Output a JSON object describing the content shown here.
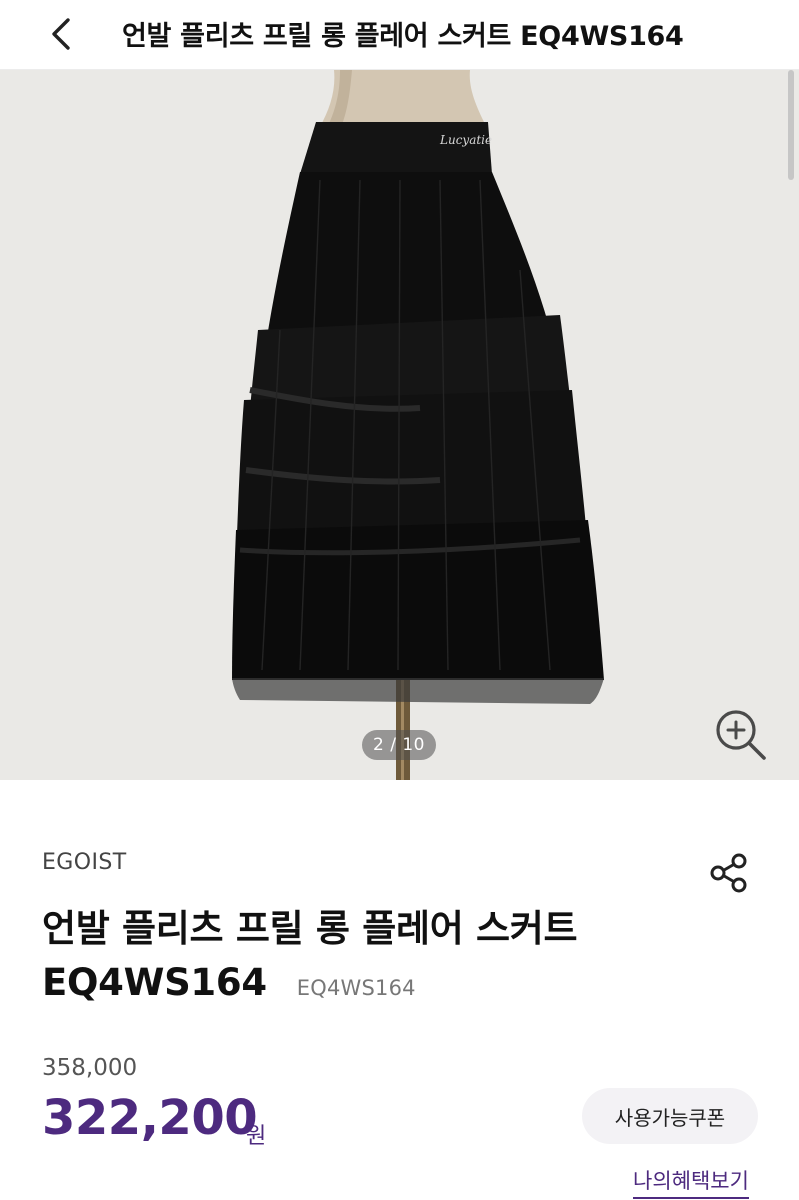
{
  "header": {
    "title": "언발 플리츠 프릴 롱 플레어 스커트 EQ4WS164"
  },
  "gallery": {
    "page_indicator": "2 / 10",
    "current": 2,
    "total": 10,
    "waistband_logo": "Lucyatie"
  },
  "product": {
    "brand": "EGOIST",
    "name": "언발 플리츠 프릴 롱 플레어 스커트 EQ4WS164",
    "code": "EQ4WS164",
    "original_price": "358,000",
    "sale_price": "322,200",
    "currency": "원",
    "coupon_button": "사용가능쿠폰",
    "benefit_link": "나의혜택보기"
  },
  "colors": {
    "accent": "#4d2a7f",
    "image_background": "#eae9e6"
  },
  "icons": {
    "back": "chevron-left-icon",
    "zoom": "zoom-in-icon",
    "share": "share-icon"
  }
}
